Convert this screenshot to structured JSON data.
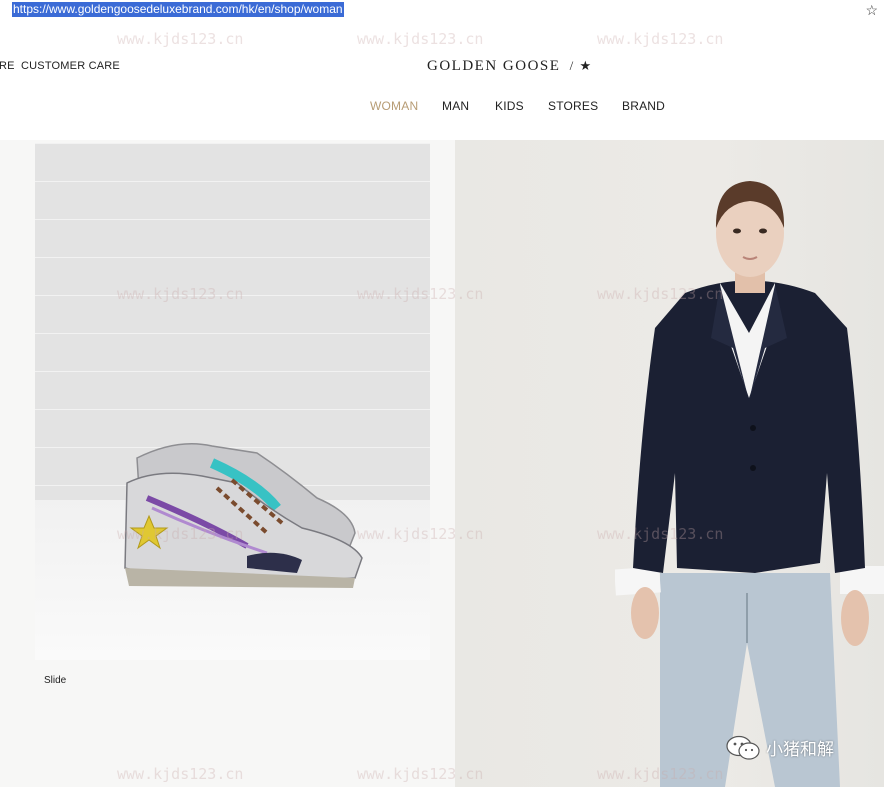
{
  "browser": {
    "url": "https://www.goldengoosedeluxebrand.com/hk/en/shop/woman",
    "bookmark_icon": "star-icon"
  },
  "header": {
    "utility_left": "RE",
    "utility_customer_care": "CUSTOMER CARE",
    "logo_text": "GOLDEN GOOSE",
    "logo_mark": "/ ★"
  },
  "nav": {
    "items": [
      "WOMAN",
      "MAN",
      "KIDS",
      "STORES",
      "BRAND"
    ],
    "active": "WOMAN",
    "active_color": "#b79c74"
  },
  "hero": {
    "slide_label": "Slide",
    "left_image": "sneaker-product-photo",
    "right_image": "model-photo"
  },
  "watermark": {
    "text": "www.kjds123.cn",
    "badge_text": "小猪和解",
    "badge_icon": "wechat-icon"
  }
}
